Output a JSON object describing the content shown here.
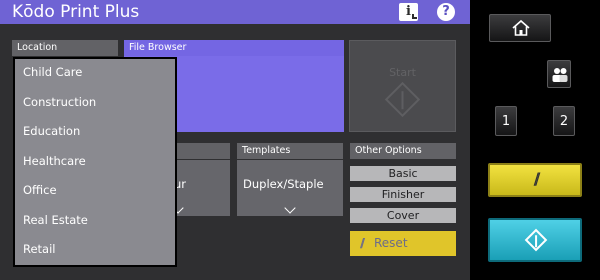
{
  "app": {
    "title": "Kōdo Print Plus"
  },
  "header": {
    "info_icon": "info-icon",
    "help_icon": "help-icon",
    "help_glyph": "?",
    "info_glyph": "i"
  },
  "location": {
    "label": "Location",
    "items": [
      "Child Care",
      "Construction",
      "Education",
      "Healthcare",
      "Office",
      "Real Estate",
      "Retail"
    ]
  },
  "file_browser": {
    "label": "File Browser"
  },
  "start_panel": {
    "label": "Start"
  },
  "color_dropdown": {
    "value_partial": "ur"
  },
  "templates": {
    "label": "Templates",
    "value": "Duplex/Staple"
  },
  "other_options": {
    "label": "Other Options",
    "buttons": [
      "Basic",
      "Finisher",
      "Cover"
    ]
  },
  "reset": {
    "label": "Reset",
    "glyph": "//"
  },
  "hardware": {
    "home_icon": "home-icon",
    "users_icon": "users-icon",
    "key_1": "1",
    "key_2": "2",
    "stop_glyph": "//",
    "start_icon": "start-icon"
  },
  "colors": {
    "accent_purple": "#6f63d4",
    "file_browser_purple": "#7a6ce8",
    "screen_bg": "#2f2f31",
    "reset_yellow": "#e0c52a",
    "start_cyan": "#2db7cc"
  }
}
